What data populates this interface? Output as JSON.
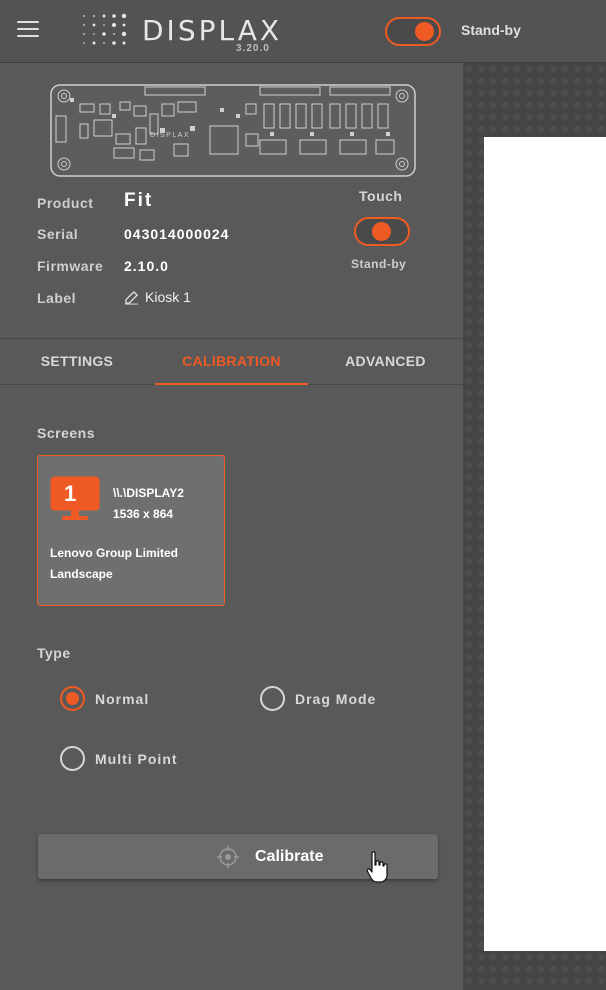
{
  "topbar": {
    "brand": "DISPLAX",
    "version": "3.20.0",
    "standby_label": "Stand-by",
    "standby_on": true
  },
  "device": {
    "product_label": "Product",
    "product_value": "Fit",
    "serial_label": "Serial",
    "serial_value": "043014000024",
    "firmware_label": "Firmware",
    "firmware_value": "2.10.0",
    "label_label": "Label",
    "label_value": "Kiosk 1",
    "board_logo": "DISPLAX",
    "touch_title": "Touch",
    "touch_standby_label": "Stand-by",
    "touch_on": true
  },
  "tabs": [
    {
      "label": "SETTINGS",
      "active": false
    },
    {
      "label": "CALIBRATION",
      "active": true
    },
    {
      "label": "ADVANCED",
      "active": false
    }
  ],
  "calibration": {
    "screens_title": "Screens",
    "screen": {
      "number": "1",
      "name": "\\\\.\\DISPLAY2",
      "resolution": "1536 x 864",
      "manufacturer": "Lenovo Group Limited",
      "orientation": "Landscape"
    },
    "type_title": "Type",
    "types": [
      {
        "label": "Normal",
        "checked": true
      },
      {
        "label": "Drag Mode",
        "checked": false
      },
      {
        "label": "Multi Point",
        "checked": false
      }
    ],
    "calibrate_label": "Calibrate"
  },
  "colors": {
    "accent": "#ef5a24",
    "sidebar_bg": "#595959",
    "topbar_bg": "#535353"
  },
  "icons": [
    "menu-icon",
    "displax-logo-icon",
    "edit-icon",
    "monitor-icon",
    "crosshair-target-icon",
    "hand-cursor-icon"
  ]
}
